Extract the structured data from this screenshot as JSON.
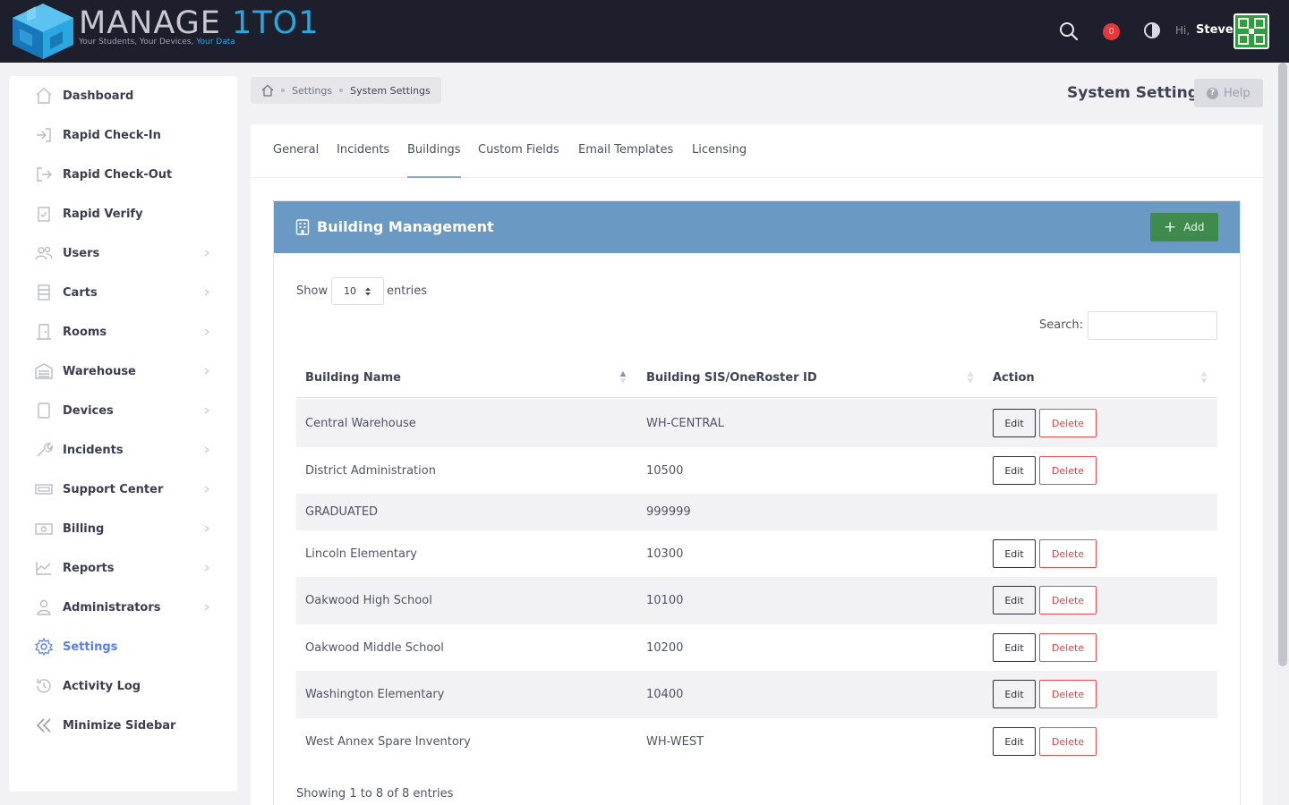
{
  "brand": {
    "name_part1": "MANAGE ",
    "name_part2": "1TO1",
    "tagline_part1": "Your Students, Your Devices, ",
    "tagline_part2": "Your Data"
  },
  "header": {
    "notification_count": "0",
    "greeting": "Hi,",
    "user_name": "Steve"
  },
  "sidebar": {
    "items": [
      {
        "label": "Dashboard",
        "icon": "home-icon",
        "chevron": false
      },
      {
        "label": "Rapid Check-In",
        "icon": "sign-in-icon",
        "chevron": false
      },
      {
        "label": "Rapid Check-Out",
        "icon": "sign-out-icon",
        "chevron": false
      },
      {
        "label": "Rapid Verify",
        "icon": "clipboard-check-icon",
        "chevron": false
      },
      {
        "label": "Users",
        "icon": "users-icon",
        "chevron": true
      },
      {
        "label": "Carts",
        "icon": "cart-icon",
        "chevron": true
      },
      {
        "label": "Rooms",
        "icon": "door-icon",
        "chevron": true
      },
      {
        "label": "Warehouse",
        "icon": "warehouse-icon",
        "chevron": true
      },
      {
        "label": "Devices",
        "icon": "tablet-icon",
        "chevron": true
      },
      {
        "label": "Incidents",
        "icon": "wrench-icon",
        "chevron": true
      },
      {
        "label": "Support Center",
        "icon": "ticket-icon",
        "chevron": true
      },
      {
        "label": "Billing",
        "icon": "money-icon",
        "chevron": true
      },
      {
        "label": "Reports",
        "icon": "chart-icon",
        "chevron": true
      },
      {
        "label": "Administrators",
        "icon": "admin-icon",
        "chevron": true
      },
      {
        "label": "Settings",
        "icon": "gear-icon",
        "chevron": false,
        "active": true
      },
      {
        "label": "Activity Log",
        "icon": "history-icon",
        "chevron": false
      },
      {
        "label": "Minimize Sidebar",
        "icon": "double-chevron-left-icon",
        "chevron": false
      }
    ]
  },
  "breadcrumb": {
    "level1": "Settings",
    "level2": "System Settings"
  },
  "page": {
    "title": "System Settings",
    "help_label": "Help"
  },
  "tabs": [
    "General",
    "Incidents",
    "Buildings",
    "Custom Fields",
    "Email Templates",
    "Licensing"
  ],
  "active_tab": "Buildings",
  "panel": {
    "title": "Building Management",
    "add_label": "Add"
  },
  "table_controls": {
    "show_label": "Show",
    "entries_label": "entries",
    "page_length": "10",
    "search_label": "Search:"
  },
  "table": {
    "columns": [
      "Building Name",
      "Building SIS/OneRoster ID",
      "Action"
    ],
    "edit_label": "Edit",
    "delete_label": "Delete",
    "rows": [
      {
        "name": "Central Warehouse",
        "id": "WH-CENTRAL",
        "actions": true
      },
      {
        "name": "District Administration",
        "id": "10500",
        "actions": true
      },
      {
        "name": "GRADUATED",
        "id": "999999",
        "actions": false
      },
      {
        "name": "Lincoln Elementary",
        "id": "10300",
        "actions": true
      },
      {
        "name": "Oakwood High School",
        "id": "10100",
        "actions": true
      },
      {
        "name": "Oakwood Middle School",
        "id": "10200",
        "actions": true
      },
      {
        "name": "Washington Elementary",
        "id": "10400",
        "actions": true
      },
      {
        "name": "West Annex Spare Inventory",
        "id": "WH-WEST",
        "actions": true
      }
    ],
    "info": "Showing 1 to 8 of 8 entries"
  },
  "colors": {
    "topbar": "#1e1f2c",
    "panel_header": "#6a9ac4",
    "add_button": "#3f8b4e",
    "accent": "#5a7ef0",
    "danger": "#d84545"
  }
}
